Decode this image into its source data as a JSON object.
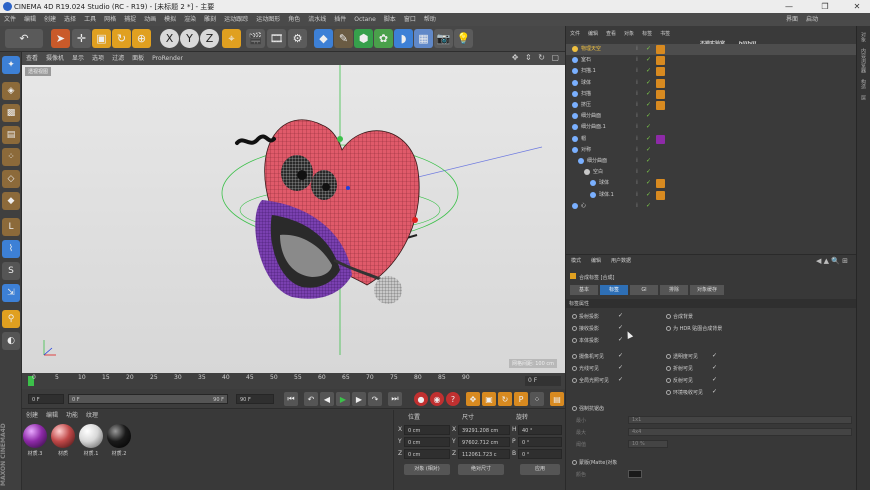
{
  "window": {
    "title": "CINEMA 4D R19.024 Studio (RC - R19) - [未标题 2 *] - 主要",
    "min": "—",
    "max": "❐",
    "close": "✕"
  },
  "menu": [
    "文件",
    "编辑",
    "创建",
    "选择",
    "工具",
    "网格",
    "捕捉",
    "动画",
    "模拟",
    "渲染",
    "雕刻",
    "运动跟踪",
    "运动图形",
    "角色",
    "流水线",
    "插件",
    "Octane",
    "脚本",
    "窗口",
    "帮助"
  ],
  "menu_right": [
    "界面",
    "启动"
  ],
  "viewport": {
    "menu": [
      "查看",
      "摄像机",
      "显示",
      "选项",
      "过滤",
      "面板",
      "ProRender"
    ],
    "label": "透视视图",
    "grid_info": "网格间距: 100 cm"
  },
  "timeline": {
    "ticks": [
      "0",
      "5",
      "10",
      "15",
      "20",
      "25",
      "30",
      "35",
      "40",
      "45",
      "50",
      "55",
      "60",
      "65",
      "70",
      "75",
      "80",
      "85",
      "90"
    ],
    "current_frame": "0 F"
  },
  "playback": {
    "start": "0 F",
    "min": "0 F",
    "max": "90 F",
    "end": "90 F"
  },
  "materials": {
    "menu": [
      "创建",
      "编辑",
      "功能",
      "纹理"
    ],
    "items": [
      {
        "label": "材质.3",
        "color": "#8e2aa8"
      },
      {
        "label": "材质",
        "color": "#c04848"
      },
      {
        "label": "材质.1",
        "color": "#d8d8d8"
      },
      {
        "label": "材质.2",
        "color": "#1a1a1a"
      }
    ]
  },
  "coords": {
    "headers": [
      "位置",
      "尺寸",
      "旋转"
    ],
    "rows": [
      {
        "axis": "X",
        "pos": "0 cm",
        "size_axis": "X",
        "size": "39291.208 cm",
        "rot_axis": "H",
        "rot": "40 °"
      },
      {
        "axis": "Y",
        "pos": "0 cm",
        "size_axis": "Y",
        "size": "97602.712 cm",
        "rot_axis": "P",
        "rot": "0 °"
      },
      {
        "axis": "Z",
        "pos": "0 cm",
        "size_axis": "Z",
        "size": "112061.723 c",
        "rot_axis": "B",
        "rot": "0 °"
      }
    ],
    "mode_left": "对象 (相对)",
    "mode_mid": "绝对尺寸",
    "apply": "应用"
  },
  "objects": {
    "menu": [
      "文件",
      "编辑",
      "查看",
      "对象",
      "标签",
      "书签"
    ],
    "watermark_text": "不错实验室",
    "watermark_logo": "bilibili",
    "rows": [
      {
        "name": "物理天空",
        "color": "#f0c040",
        "indent": 0,
        "selected": true
      },
      {
        "name": "室石",
        "color": "#7ab0ff",
        "indent": 0
      },
      {
        "name": "扫描.1",
        "color": "#7ab0ff",
        "indent": 0
      },
      {
        "name": "球体",
        "color": "#7ab0ff",
        "indent": 0
      },
      {
        "name": "扫描",
        "color": "#7ab0ff",
        "indent": 0
      },
      {
        "name": "挤压",
        "color": "#7ab0ff",
        "indent": 0
      },
      {
        "name": "细分曲面",
        "color": "#7ab0ff",
        "indent": 0
      },
      {
        "name": "细分曲面.1",
        "color": "#7ab0ff",
        "indent": 0
      },
      {
        "name": "帽",
        "color": "#7ab0ff",
        "indent": 0
      },
      {
        "name": "对称",
        "color": "#7ab0ff",
        "indent": 0
      },
      {
        "name": "细分曲面",
        "color": "#7ab0ff",
        "indent": 1
      },
      {
        "name": "空白",
        "color": "#c8c8c8",
        "indent": 2
      },
      {
        "name": "球体",
        "color": "#7ab0ff",
        "indent": 3
      },
      {
        "name": "球体.1",
        "color": "#7ab0ff",
        "indent": 3
      },
      {
        "name": "心",
        "color": "#7ab0ff",
        "indent": 0
      }
    ]
  },
  "attributes": {
    "menu": [
      "模式",
      "编辑",
      "用户数据"
    ],
    "title": "合成标签 [合成]",
    "tabs": [
      "基本",
      "标签",
      "GI",
      "排除",
      "对象缓存"
    ],
    "section": "标签属性",
    "left_opts": [
      "投射投影",
      "接收投影",
      "本体投影",
      "摄像机可见",
      "光线可见",
      "全局光照可见"
    ],
    "right_opts": [
      "合成背景",
      "为 HDR 贴图合成背景",
      "透明度可见",
      "折射可见",
      "反射可见",
      "环境吸收可见"
    ],
    "matte_section": "强制抗锯齿",
    "min_label": "最小",
    "min_val": "1x1",
    "max_label": "最大",
    "max_val": "4x4",
    "threshold_label": "阈值",
    "threshold_val": "10 %",
    "matte_label": "蒙版(Matte)对象",
    "color_label": "颜色"
  },
  "right_strip": [
    "对象",
    "内容浏览器",
    "构造",
    "层"
  ]
}
